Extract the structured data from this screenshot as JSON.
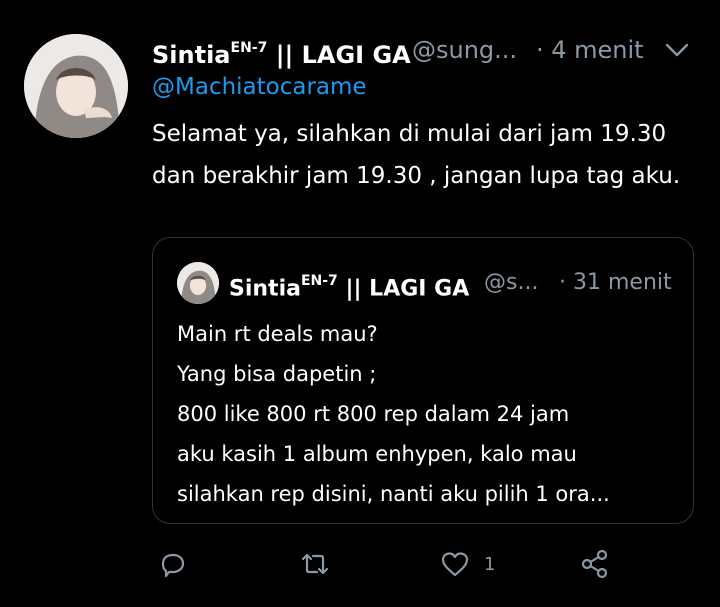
{
  "tweet": {
    "display_name": "Sintia",
    "name_sup": "EN-7",
    "name_suffix": " || LAGI GA",
    "handle": "@sung...",
    "time": "· 4 menit",
    "mention": "@Machiatocarame",
    "text": "Selamat ya, silahkan di mulai dari jam 19.30 dan berakhir jam 19.30 , jangan lupa tag aku."
  },
  "quote": {
    "display_name": "Sintia",
    "name_sup": "EN-7",
    "name_suffix": " || LAGI GA",
    "handle": "@s...",
    "time": "· 31 menit",
    "lines": [
      "Main rt deals mau?",
      "Yang bisa dapetin ;",
      "800 like 800 rt 800 rep dalam 24 jam",
      "aku kasih 1 album enhypen, kalo mau",
      "silahkan rep disini, nanti aku pilih 1 ora..."
    ]
  },
  "actions": {
    "reply_count": "",
    "retweet_count": "",
    "like_count": "1"
  },
  "icons": {
    "reply": "reply-icon",
    "retweet": "retweet-icon",
    "like": "heart-icon",
    "share": "share-icon",
    "more": "chevron-down-icon"
  },
  "colors": {
    "background": "#000000",
    "accent": "#1d9bf0",
    "muted": "#8b98a5",
    "border": "#2f3336"
  }
}
